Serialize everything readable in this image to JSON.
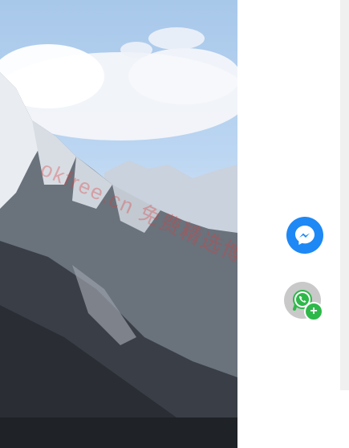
{
  "hero": {
    "alt_description_icon": "mountain-photo",
    "watermark_text": "okfree.cn 免费精选博客"
  },
  "social_buttons": {
    "messenger": {
      "icon": "messenger-icon",
      "color": "#1e88f5"
    },
    "whatsapp": {
      "icon": "whatsapp-icon",
      "badge_icon": "plus-icon",
      "badge_color": "#2fb84a"
    }
  }
}
